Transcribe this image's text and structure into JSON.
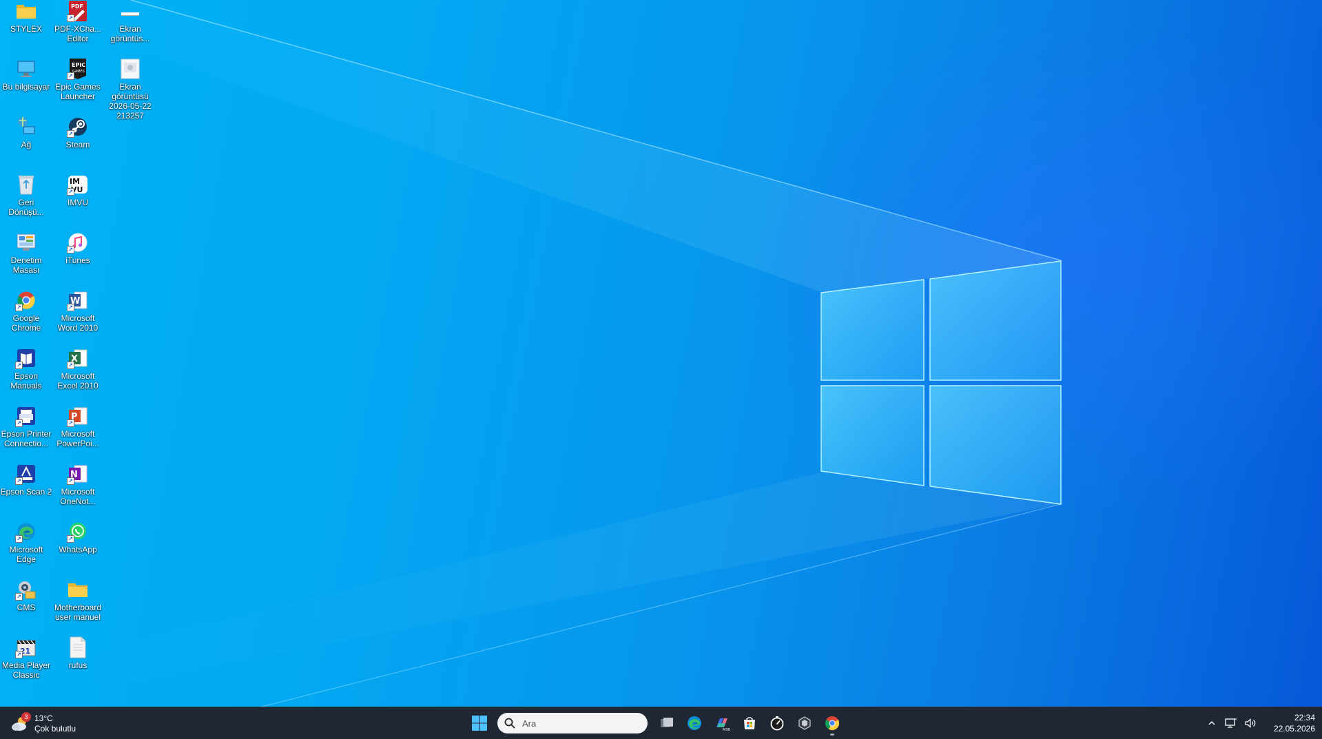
{
  "desktop": {
    "icons": [
      {
        "label": "STYLEX",
        "icon": "folder-icon"
      },
      {
        "label": "PDF-XCha...\nEditor",
        "icon": "pdf-xchange-icon"
      },
      {
        "label": "Ekran\ngörüntüs...",
        "icon": "screenshot-file-icon"
      },
      {
        "label": "Bu bilgisayar",
        "icon": "this-pc-icon"
      },
      {
        "label": "Epic Games\nLauncher",
        "icon": "epic-games-icon"
      },
      {
        "label": "Ekran\ngörüntüsü\n2026-05-22\n213257",
        "icon": "screenshot-image-icon"
      },
      {
        "label": "Ağ",
        "icon": "network-icon"
      },
      {
        "label": "Steam",
        "icon": "steam-icon"
      },
      {
        "label": "Geri\nDönüşü...",
        "icon": "recycle-bin-icon"
      },
      {
        "label": "IMVU",
        "icon": "imvu-icon"
      },
      {
        "label": "Denetim\nMasası",
        "icon": "control-panel-icon"
      },
      {
        "label": "iTunes",
        "icon": "itunes-icon"
      },
      {
        "label": "Google\nChrome",
        "icon": "chrome-icon"
      },
      {
        "label": "Microsoft\nWord 2010",
        "icon": "word-icon"
      },
      {
        "label": "Epson\nManuals",
        "icon": "epson-manuals-icon"
      },
      {
        "label": "Microsoft\nExcel 2010",
        "icon": "excel-icon"
      },
      {
        "label": "Epson Printer\nConnectio...",
        "icon": "epson-printer-icon"
      },
      {
        "label": "Microsoft\nPowerPoi...",
        "icon": "powerpoint-icon"
      },
      {
        "label": "Epson Scan 2",
        "icon": "epson-scan-icon"
      },
      {
        "label": "Microsoft\nOneNot...",
        "icon": "onenote-icon"
      },
      {
        "label": "Microsoft\nEdge",
        "icon": "edge-icon"
      },
      {
        "label": "WhatsApp",
        "icon": "whatsapp-icon"
      },
      {
        "label": "CMS",
        "icon": "cms-icon"
      },
      {
        "label": "Motherboard\nuser manuel",
        "icon": "folder-icon"
      },
      {
        "label": "Media Player\nClassic",
        "icon": "media-player-classic-icon"
      },
      {
        "label": "rufus",
        "icon": "text-file-icon"
      }
    ]
  },
  "taskbar": {
    "weather": {
      "temperature": "13°C",
      "condition": "Çok bulutlu",
      "badge": "3",
      "icon": "weather-cloudy-icon"
    },
    "search": {
      "placeholder": "Ara"
    },
    "pinned": [
      {
        "name": "task-view",
        "icon": "task-view-icon"
      },
      {
        "name": "edge",
        "icon": "edge-icon"
      },
      {
        "name": "m365-copilot",
        "icon": "m365-copilot-icon"
      },
      {
        "name": "microsoft-store",
        "icon": "store-icon"
      },
      {
        "name": "clock-app",
        "icon": "stopwatch-icon"
      },
      {
        "name": "unity-hub",
        "icon": "unity-icon"
      },
      {
        "name": "chrome",
        "icon": "chrome-icon"
      }
    ],
    "tray": {
      "time": "22:34",
      "date": "22.05.2026"
    }
  },
  "colors": {
    "taskbar_bg": "#202734",
    "wallpaper_light": "#00b4f6",
    "wallpaper_dark": "#0658d8"
  }
}
